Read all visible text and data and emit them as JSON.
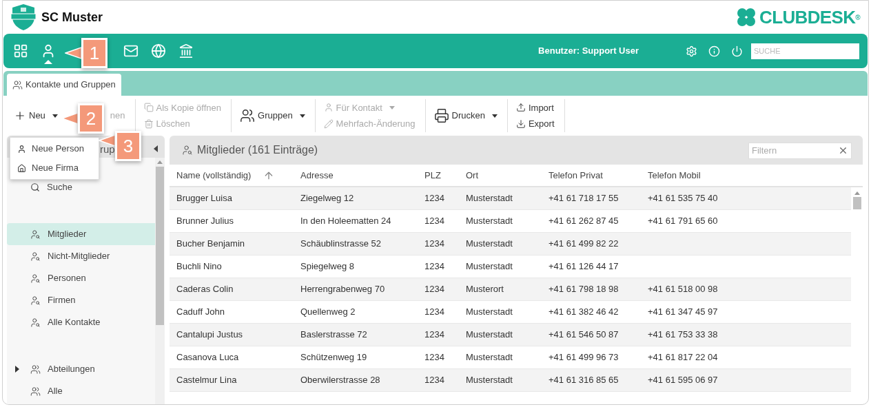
{
  "header": {
    "club_name": "SC Muster",
    "brand": "CLUBDESK",
    "brand_mark": "®"
  },
  "nav": {
    "items": [
      {
        "kind": "dashboard",
        "selected": false
      },
      {
        "kind": "contacts",
        "selected": true
      },
      {
        "kind": "mail",
        "selected": false
      },
      {
        "kind": "web",
        "selected": false
      },
      {
        "kind": "finance",
        "selected": false
      }
    ],
    "user_label": "Benutzer: Support User",
    "search_placeholder": "SUCHE"
  },
  "tabs": [
    {
      "label": "Kontakte und Gruppen",
      "selected": true
    }
  ],
  "toolbar": [
    [
      {
        "kind": "new",
        "label": "Neu",
        "dropdown": true,
        "disabled": false
      },
      {
        "kind": "open",
        "label": "nen",
        "dropdown": false,
        "disabled": true
      }
    ],
    [
      {
        "kind": "copy",
        "label": "Als Kopie öffnen",
        "dropdown": false,
        "disabled": true
      },
      {
        "kind": "delete",
        "label": "Löschen",
        "dropdown": false,
        "disabled": true
      }
    ],
    [
      {
        "kind": "groups",
        "label": "Gruppen",
        "dropdown": true,
        "disabled": false
      }
    ],
    [
      {
        "kind": "contact",
        "label": "Für Kontakt",
        "dropdown": true,
        "disabled": true
      },
      {
        "kind": "edit",
        "label": "Mehrfach-Änderung",
        "dropdown": false,
        "disabled": true
      }
    ],
    [
      {
        "kind": "print",
        "label": "Drucken",
        "dropdown": true,
        "disabled": false
      }
    ],
    [
      {
        "kind": "import",
        "label": "Import",
        "dropdown": false,
        "disabled": false
      },
      {
        "kind": "export",
        "label": "Export",
        "dropdown": false,
        "disabled": false
      }
    ]
  ],
  "new_menu": [
    {
      "kind": "person",
      "label": "Neue Person"
    },
    {
      "kind": "company",
      "label": "Neue Firma"
    }
  ],
  "sidebar": {
    "title": "rup",
    "sections": [
      [
        {
          "kind": "search",
          "label": "Suche",
          "selected": false,
          "expandable": false
        }
      ],
      [
        {
          "kind": "filter",
          "label": "Mitglieder",
          "selected": true,
          "expandable": false
        },
        {
          "kind": "filter",
          "label": "Nicht-Mitglieder",
          "selected": false,
          "expandable": false
        },
        {
          "kind": "filter",
          "label": "Personen",
          "selected": false,
          "expandable": false
        },
        {
          "kind": "filter",
          "label": "Firmen",
          "selected": false,
          "expandable": false
        },
        {
          "kind": "filter",
          "label": "Alle Kontakte",
          "selected": false,
          "expandable": false
        }
      ],
      [
        {
          "kind": "group",
          "label": "Abteilungen",
          "selected": false,
          "expandable": true
        },
        {
          "kind": "group",
          "label": "Alle",
          "selected": false,
          "expandable": false
        }
      ]
    ]
  },
  "panel": {
    "title": "Mitglieder (161 Einträge)",
    "filter_placeholder": "Filtern"
  },
  "table": {
    "columns": [
      "Name (vollständig)",
      "Adresse",
      "PLZ",
      "Ort",
      "Telefon Privat",
      "Telefon Mobil"
    ],
    "rows": [
      [
        "Brugger Luisa",
        "Ziegelweg 12",
        "1234",
        "Musterstadt",
        "+41 61 718 17 55",
        "+41 61 535 75 40"
      ],
      [
        "Brunner Julius",
        "In den Holeematten 24",
        "1234",
        "Musterstadt",
        "+41 61 262 87 45",
        "+41 61 791 65 60"
      ],
      [
        "Bucher Benjamin",
        "Schäublinstrasse 52",
        "1234",
        "Musterstadt",
        "+41 61 499 82 22",
        ""
      ],
      [
        "Buchli Nino",
        "Spiegelweg 8",
        "1234",
        "Musterstadt",
        "+41 61 126 44 17",
        ""
      ],
      [
        "Caderas Colin",
        "Herrengrabenweg 70",
        "1234",
        "Musterort",
        "+41 61 798 18 98",
        "+41 61 518 00 98"
      ],
      [
        "Caduff John",
        "Quellenweg 2",
        "1234",
        "Musterstadt",
        "+41 61 382 46 42",
        "+41 61 347 45 97"
      ],
      [
        "Cantalupi Justus",
        "Baslerstrasse 72",
        "1234",
        "Musterstadt",
        "+41 61 546 50 87",
        "+41 61 753 33 38"
      ],
      [
        "Casanova Luca",
        "Schützenweg 19",
        "1234",
        "Musterstadt",
        "+41 61 499 96 73",
        "+41 61 817 22 04"
      ],
      [
        "Castelmur Lina",
        "Oberwilerstrasse 28",
        "1234",
        "Musterstadt",
        "+41 61 316 85 65",
        "+41 61 595 06 97"
      ]
    ]
  },
  "callouts": [
    "1",
    "2",
    "3"
  ]
}
